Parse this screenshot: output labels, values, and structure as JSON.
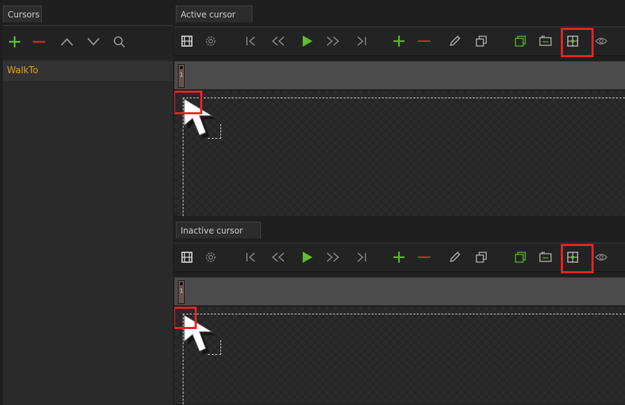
{
  "tabs": {
    "cursors": "Cursors",
    "active_cursor": "Active cursor",
    "inactive_cursor": "Inactive cursor"
  },
  "cursor_list": {
    "items": [
      {
        "label": "WalkTo",
        "selected": true
      }
    ]
  },
  "left_toolbar_icons": [
    "add-icon",
    "remove-icon",
    "move-up-icon",
    "move-down-icon",
    "search-icon"
  ],
  "editor_toolbar_icons": [
    "filmstrip-icon",
    "settings-icon",
    "first-frame-icon",
    "previous-frame-icon",
    "play-icon",
    "next-frame-icon",
    "last-frame-icon",
    "add-frame-icon",
    "remove-frame-icon",
    "edit-icon",
    "duplicate-icon",
    "copy-icon",
    "frame-sequence-icon",
    "hotspot-icon",
    "visibility-icon"
  ],
  "active_editor": {
    "frame_number": "1",
    "hotspot_button_highlighted": true,
    "hotspot_highlighted": true
  },
  "inactive_editor": {
    "frame_number": "1",
    "hotspot_button_highlighted": true,
    "hotspot_highlighted": true
  },
  "colors": {
    "add": "#5bbf2f",
    "remove": "#d0282d",
    "play": "#5bbf2f",
    "selected_item_text": "#e0a020",
    "highlight": "#ee2222"
  }
}
